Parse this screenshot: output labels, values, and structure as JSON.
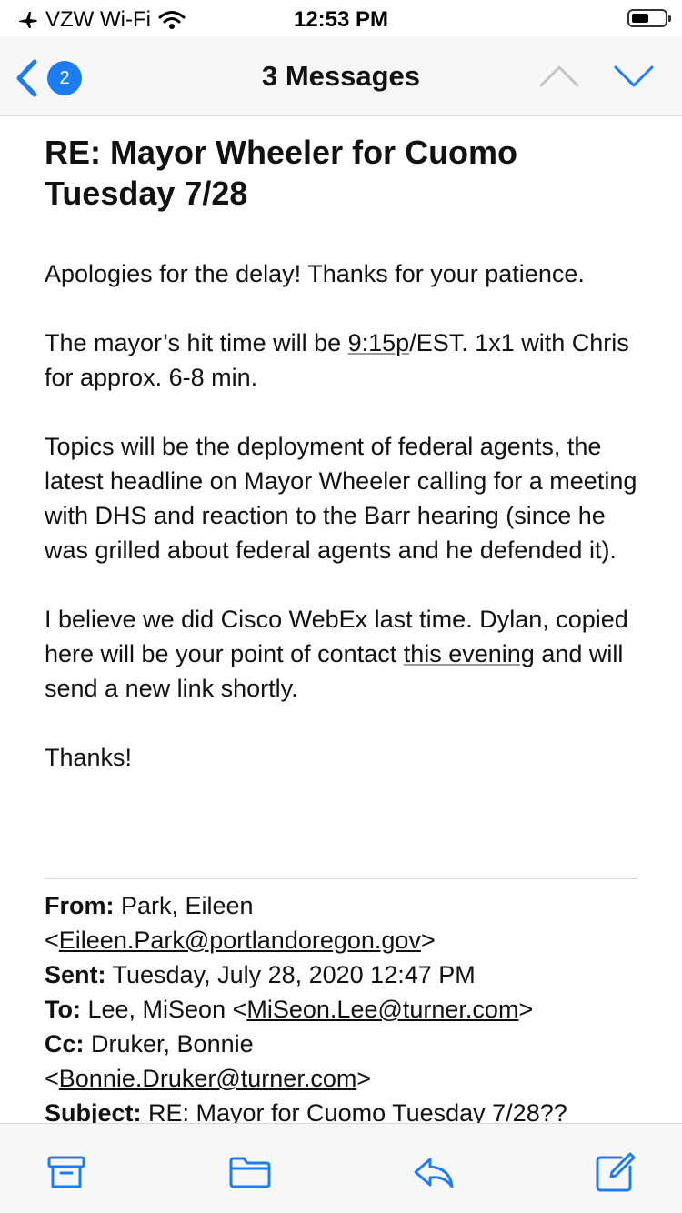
{
  "status_bar": {
    "carrier": "VZW Wi-Fi",
    "time": "12:53 PM",
    "icons": [
      "airplane-icon",
      "wifi-icon",
      "battery-icon"
    ]
  },
  "nav": {
    "unread_count": "2",
    "title": "3 Messages",
    "accent_color": "#1e7cf2"
  },
  "email": {
    "subject": "RE:  Mayor Wheeler for Cuomo Tuesday 7/28",
    "paragraphs": {
      "p1": "Apologies for the delay! Thanks for your patience.",
      "p2a": "The mayor’s hit time will be ",
      "p2_time": "9:15p",
      "p2b": "/EST.   1x1 with Chris for approx. 6-8 min.",
      "p3": "Topics will be the deployment of federal agents, the latest headline on Mayor Wheeler calling for a meeting with DHS and reaction to the Barr hearing (since he was grilled about federal agents and he defended it).",
      "p4a": "I believe we did Cisco WebEx last time. Dylan, copied here will be your point of contact ",
      "p4_link": "this evening",
      "p4b": " and will send a new link shortly.",
      "p5": "Thanks!"
    },
    "quoted": {
      "from_label": "From:",
      "from_name": " Park, Eileen",
      "from_email": "Eileen.Park@portlandoregon.gov",
      "sent_label": "Sent:",
      "sent_value": " Tuesday, July 28, 2020 12:47 PM",
      "to_label": "To:",
      "to_name": " Lee, MiSeon ",
      "to_email": "MiSeon.Lee@turner.com",
      "cc_label": "Cc:",
      "cc_name": " Druker, Bonnie",
      "cc_email": "Bonnie.Druker@turner.com",
      "subject_label": "Subject:",
      "subject_value": " RE: Mayor for Cuomo Tuesday 7/28??"
    }
  },
  "toolbar": {
    "icons": [
      "archive-icon",
      "folder-icon",
      "reply-icon",
      "compose-icon"
    ]
  }
}
